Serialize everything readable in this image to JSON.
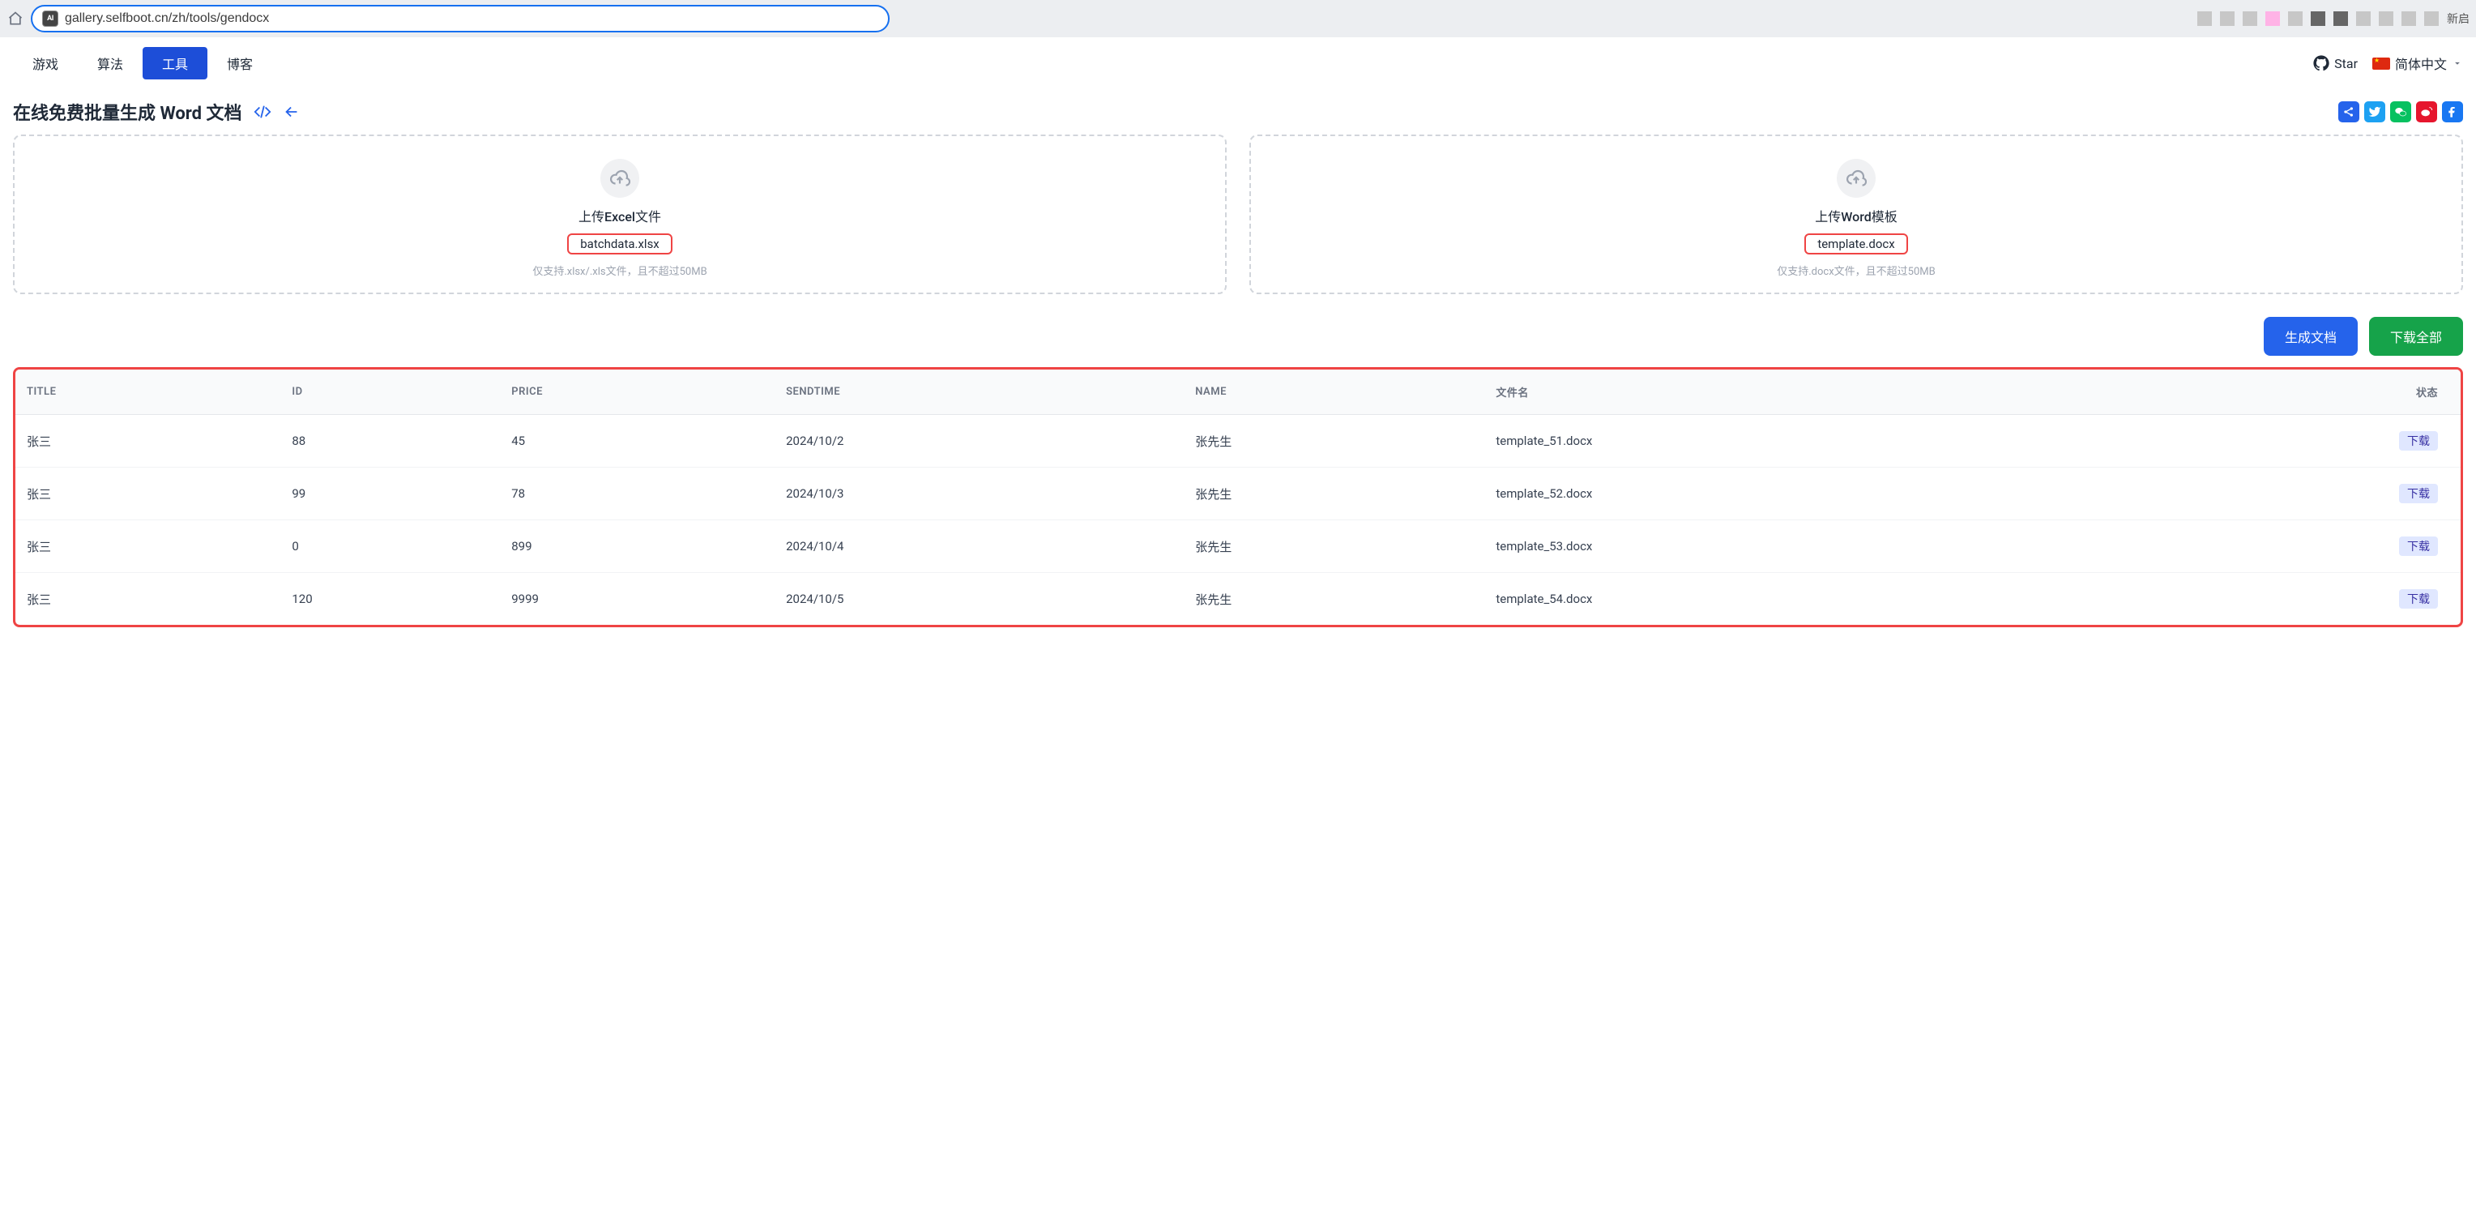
{
  "browser": {
    "url": "gallery.selfboot.cn/zh/tools/gendocx",
    "site_icon_text": "AI",
    "new_window_hint": "新启"
  },
  "nav": {
    "items": [
      {
        "label": "游戏",
        "active": false
      },
      {
        "label": "算法",
        "active": false
      },
      {
        "label": "工具",
        "active": true
      },
      {
        "label": "博客",
        "active": false
      }
    ],
    "star_label": "Star",
    "lang_label": "简体中文"
  },
  "page": {
    "title": "在线免费批量生成 Word 文档"
  },
  "upload": {
    "excel": {
      "title": "上传Excel文件",
      "filename": "batchdata.xlsx",
      "hint": "仅支持.xlsx/.xls文件，且不超过50MB"
    },
    "word": {
      "title": "上传Word模板",
      "filename": "template.docx",
      "hint": "仅支持.docx文件，且不超过50MB"
    }
  },
  "actions": {
    "generate": "生成文档",
    "download_all": "下载全部"
  },
  "table": {
    "headers": {
      "title": "TITLE",
      "id": "ID",
      "price": "PRICE",
      "sendtime": "SENDTIME",
      "name": "NAME",
      "filename": "文件名",
      "status": "状态"
    },
    "download_label": "下载",
    "rows": [
      {
        "title": "张三",
        "id": "88",
        "price": "45",
        "sendtime": "2024/10/2",
        "name": "张先生",
        "filename": "template_51.docx"
      },
      {
        "title": "张三",
        "id": "99",
        "price": "78",
        "sendtime": "2024/10/3",
        "name": "张先生",
        "filename": "template_52.docx"
      },
      {
        "title": "张三",
        "id": "0",
        "price": "899",
        "sendtime": "2024/10/4",
        "name": "张先生",
        "filename": "template_53.docx"
      },
      {
        "title": "张三",
        "id": "120",
        "price": "9999",
        "sendtime": "2024/10/5",
        "name": "张先生",
        "filename": "template_54.docx"
      }
    ]
  }
}
